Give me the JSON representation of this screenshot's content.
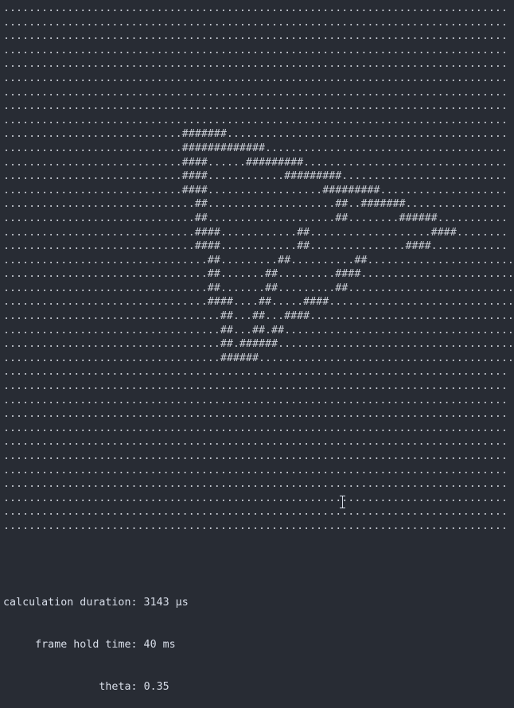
{
  "ascii_frame": [
    "...............................................................................",
    "...............................................................................",
    "...............................................................................",
    "...............................................................................",
    "...............................................................................",
    "...............................................................................",
    "...............................................................................",
    "...............................................................................",
    "...............................................................................",
    "............................#######............................................",
    "............................#############......................................",
    "............................####......#########................................",
    "............................####............#########..........................",
    "............................####..................#########....................",
    "..............................##....................##..#######................",
    "..............................##....................##........######...........",
    "..............................####............##...................####........",
    "..............................####............##...............####............",
    "................................##.........##..........##.......................",
    "................................##.......##.........####........................",
    "................................##.......##.........##..........................",
    "................................####....##.....####.............................",
    "..................................##...##...####................................",
    "..................................##...##.##....................................",
    "..................................##.######.....................................",
    "..................................######........................................",
    "...............................................................................",
    "...............................................................................",
    "...............................................................................",
    "...............................................................................",
    "...............................................................................",
    "...............................................................................",
    "...............................................................................",
    "...............................................................................",
    "...............................................................................",
    "...............................................................................",
    "...............................................................................",
    "..............................................................................."
  ],
  "status": {
    "calc_label": "calculation duration:",
    "calc_value": "3143 μs",
    "hold_label": "frame hold time:",
    "hold_value": "40 ms",
    "theta_label": "theta:",
    "theta_value": "0.35"
  },
  "icons": {
    "cursor": "text-cursor-icon"
  },
  "colors": {
    "background": "#282c34",
    "text": "#d8dee9"
  }
}
